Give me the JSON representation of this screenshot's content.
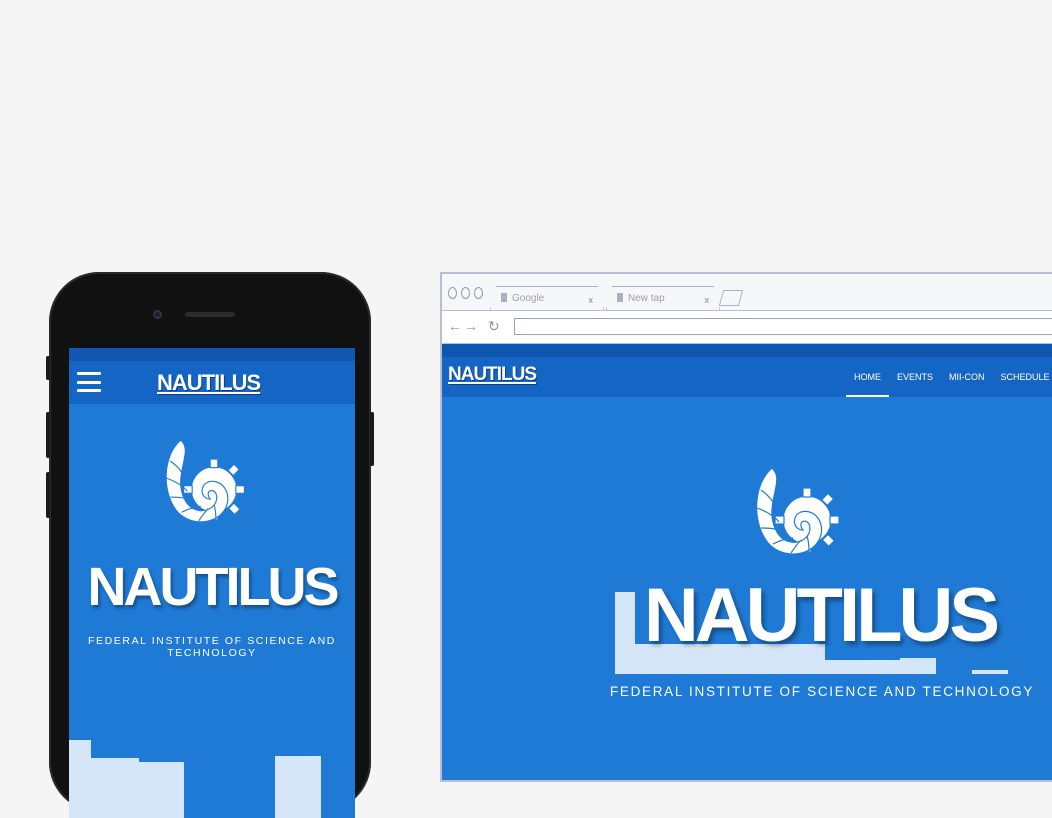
{
  "phone": {
    "brand": "NAUTILUS",
    "hero_title": "NAUTILUS",
    "hero_subtitle": "FEDERAL INSTITUTE OF SCIENCE AND TECHNOLOGY",
    "menu_icon": "hamburger-menu-icon",
    "logo_icon": "nautilus-shell-gear-logo"
  },
  "browser": {
    "tabs": [
      {
        "label": "Google",
        "close": "x"
      },
      {
        "label": "New tap",
        "close": "x"
      }
    ],
    "nav_icons": [
      "back-arrow-icon",
      "forward-arrow-icon",
      "reload-icon"
    ],
    "url": "",
    "page": {
      "brand": "NAUTILUS",
      "menu": [
        "HOME",
        "EVENTS",
        "MII-CON",
        "SCHEDULE"
      ],
      "active_menu": "HOME",
      "hero_title": "NAUTILUS",
      "hero_subtitle": "FEDERAL INSTITUTE OF SCIENCE AND TECHNOLOGY"
    }
  },
  "colors": {
    "background": "#f5f5f5",
    "brand_blue": "#1f7ad6",
    "nav_blue": "#1565c4",
    "strip_blue": "#1055b0",
    "block_light": "#d4e6f7"
  }
}
